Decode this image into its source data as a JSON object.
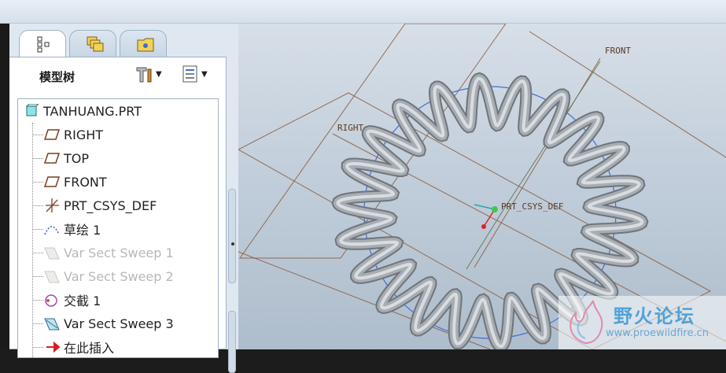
{
  "panel": {
    "title": "模型树",
    "tabs": [
      {
        "icon": "model-tree-icon",
        "active": true
      },
      {
        "icon": "layers-icon",
        "active": false
      },
      {
        "icon": "folder-browser-icon",
        "active": false
      }
    ]
  },
  "tree": {
    "root": "TANHUANG.PRT",
    "items": [
      {
        "label": "RIGHT",
        "icon": "datum-plane-icon",
        "disabled": false
      },
      {
        "label": "TOP",
        "icon": "datum-plane-icon",
        "disabled": false
      },
      {
        "label": "FRONT",
        "icon": "datum-plane-icon",
        "disabled": false
      },
      {
        "label": "PRT_CSYS_DEF",
        "icon": "csys-icon",
        "disabled": false
      },
      {
        "label": "草绘 1",
        "icon": "sketch-icon",
        "disabled": false
      },
      {
        "label": "Var Sect Sweep 1",
        "icon": "sweep-icon",
        "disabled": true
      },
      {
        "label": "Var Sect Sweep 2",
        "icon": "sweep-icon",
        "disabled": true
      },
      {
        "label": "交截 1",
        "icon": "intersect-icon",
        "disabled": false
      },
      {
        "label": "Var Sect Sweep 3",
        "icon": "sweep-icon",
        "disabled": false
      },
      {
        "label": "在此插入",
        "icon": "insert-here-icon",
        "disabled": false
      }
    ]
  },
  "viewport": {
    "labels": {
      "front": "FRONT",
      "right": "RIGHT",
      "csys": "PRT_CSYS_DEF"
    }
  },
  "watermark": {
    "name": "野火论坛",
    "url": "www.proewildfire.cn"
  },
  "colors": {
    "spring": "#9ea3a8",
    "curve": "#3f6fd6",
    "datum": "#8a5a3a"
  }
}
